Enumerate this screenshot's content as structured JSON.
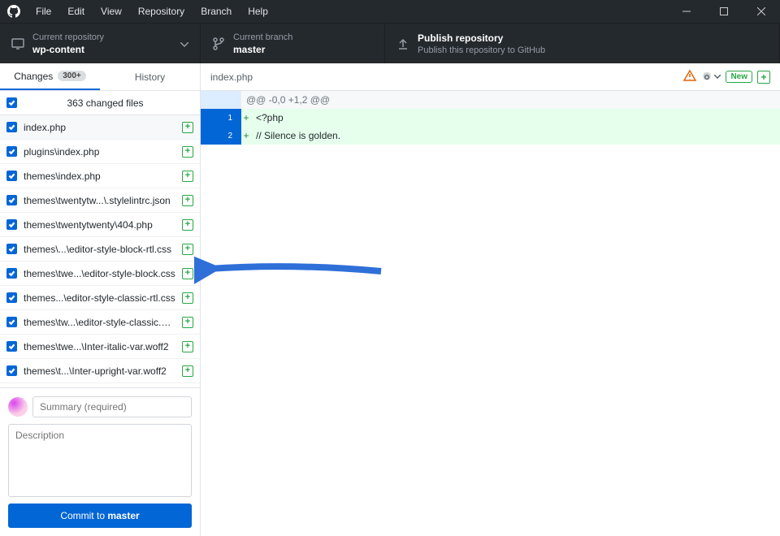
{
  "menu": [
    "File",
    "Edit",
    "View",
    "Repository",
    "Branch",
    "Help"
  ],
  "toolbar": {
    "repo_label": "Current repository",
    "repo_value": "wp-content",
    "branch_label": "Current branch",
    "branch_value": "master",
    "publish_title": "Publish repository",
    "publish_sub": "Publish this repository to GitHub"
  },
  "tabs": {
    "changes": "Changes",
    "changes_count": "300+",
    "history": "History"
  },
  "changes_header": "363 changed files",
  "files": [
    {
      "name": "index.php",
      "checked": true,
      "selected": true
    },
    {
      "name": "plugins\\index.php",
      "checked": true
    },
    {
      "name": "themes\\index.php",
      "checked": true
    },
    {
      "name": "themes\\twentytw...\\.stylelintrc.json",
      "checked": true
    },
    {
      "name": "themes\\twentytwenty\\404.php",
      "checked": true
    },
    {
      "name": "themes\\...\\editor-style-block-rtl.css",
      "checked": true
    },
    {
      "name": "themes\\twe...\\editor-style-block.css",
      "checked": true
    },
    {
      "name": "themes...\\editor-style-classic-rtl.css",
      "checked": true
    },
    {
      "name": "themes\\tw...\\editor-style-classic.css",
      "checked": true
    },
    {
      "name": "themes\\twe...\\Inter-italic-var.woff2",
      "checked": true
    },
    {
      "name": "themes\\t...\\Inter-upright-var.woff2",
      "checked": true
    }
  ],
  "commit": {
    "summary_placeholder": "Summary (required)",
    "desc_placeholder": "Description",
    "button_prefix": "Commit to ",
    "button_branch": "master"
  },
  "diff": {
    "filename": "index.php",
    "new_badge": "New",
    "hunk": "@@ -0,0 +1,2 @@",
    "lines": [
      {
        "n": "1",
        "text": "<?php"
      },
      {
        "n": "2",
        "text": "// Silence is golden."
      }
    ]
  }
}
